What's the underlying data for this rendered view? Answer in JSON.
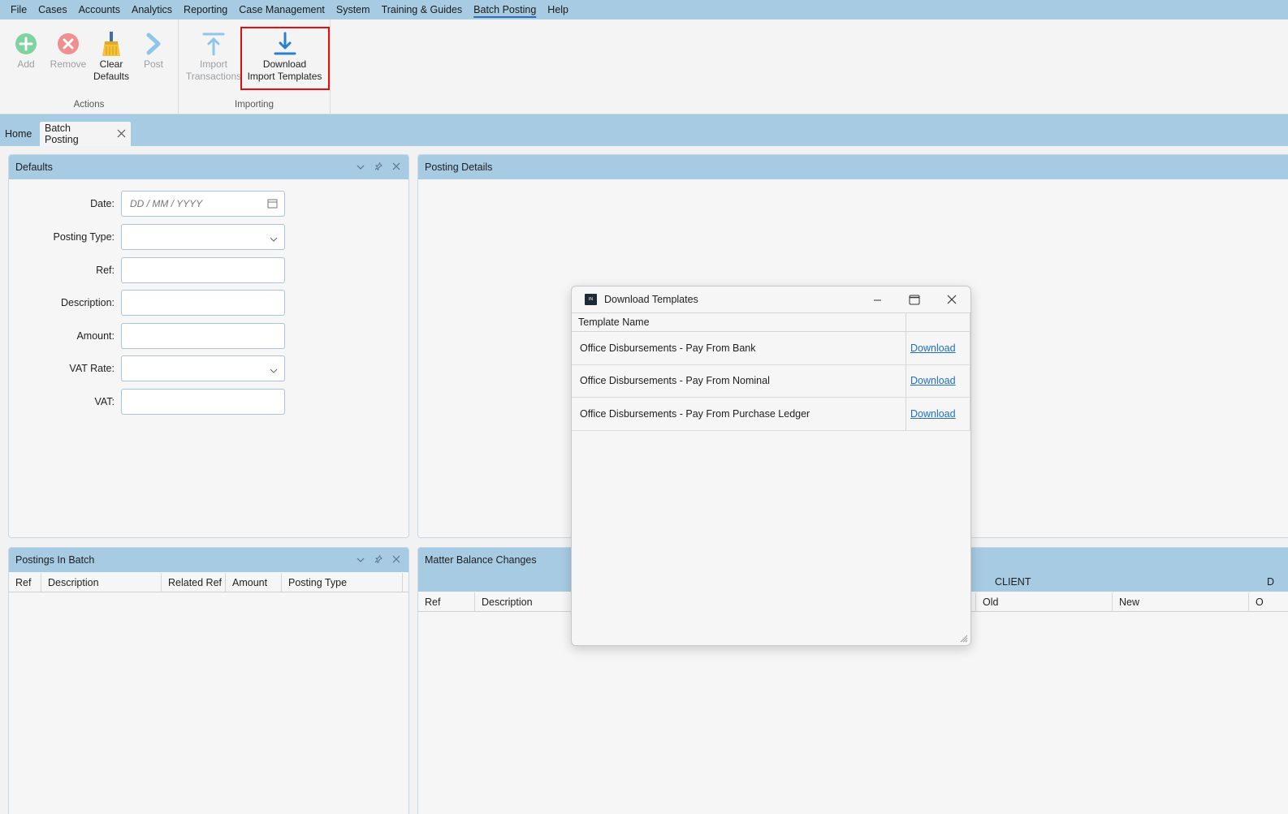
{
  "menu": {
    "items": [
      "File",
      "Cases",
      "Accounts",
      "Analytics",
      "Reporting",
      "Case Management",
      "System",
      "Training & Guides",
      "Batch Posting",
      "Help"
    ],
    "active_index": 8
  },
  "ribbon": {
    "actions_group_label": "Actions",
    "importing_group_label": "Importing",
    "add_label": "Add",
    "remove_label": "Remove",
    "clear_defaults_label_1": "Clear",
    "clear_defaults_label_2": "Defaults",
    "post_label": "Post",
    "import_label_1": "Import",
    "import_label_2": "Transactions",
    "download_label_1": "Download",
    "download_label_2": "Import Templates"
  },
  "tabs": {
    "home": "Home",
    "batch_posting": "Batch Posting"
  },
  "defaults_panel": {
    "title": "Defaults",
    "fields": {
      "date_label": "Date:",
      "date_placeholder": "DD / MM / YYYY",
      "posting_type_label": "Posting Type:",
      "ref_label": "Ref:",
      "description_label": "Description:",
      "amount_label": "Amount:",
      "vat_rate_label": "VAT Rate:",
      "vat_label": "VAT:"
    }
  },
  "posting_details_panel": {
    "title": "Posting Details"
  },
  "postings_panel": {
    "title": "Postings In Batch",
    "columns": [
      "Ref",
      "Description",
      "Related Ref",
      "Amount",
      "Posting Type"
    ]
  },
  "matter_panel": {
    "title": "Matter Balance Changes",
    "group_client": "CLIENT",
    "group_d": "D",
    "columns": [
      "Ref",
      "Description"
    ],
    "client_columns": [
      "Old",
      "New"
    ],
    "trailing_column": "O"
  },
  "dialog": {
    "title": "Download Templates",
    "logo_text": "IN",
    "column_header": "Template Name",
    "rows": [
      {
        "name": "Office Disbursements - Pay From Bank",
        "link": "Download"
      },
      {
        "name": "Office Disbursements - Pay From Nominal",
        "link": "Download"
      },
      {
        "name": "Office Disbursements - Pay From Purchase Ledger",
        "link": "Download"
      }
    ]
  },
  "colors": {
    "accent": "#a7cbe3",
    "highlight": "#e01010",
    "link": "#1f6fbf",
    "add_green": "#6fcf97",
    "remove_red": "#eb8a8a"
  }
}
